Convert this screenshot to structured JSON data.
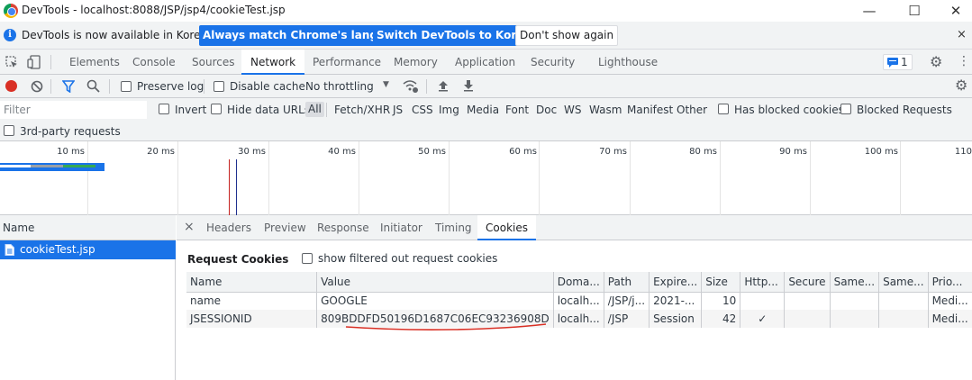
{
  "window": {
    "title": "DevTools - localhost:8088/JSP/jsp4/cookieTest.jsp",
    "minimize": "—",
    "maximize": "☐",
    "close": "✕"
  },
  "infobar": {
    "icon": "info-icon",
    "message": "DevTools is now available in Korean!",
    "buttons": [
      "Always match Chrome's language",
      "Switch DevTools to Korean",
      "Don't show again"
    ],
    "close": "×"
  },
  "panel_tabs": [
    "Elements",
    "Console",
    "Sources",
    "Network",
    "Performance",
    "Memory",
    "Application",
    "Security",
    "Lighthouse"
  ],
  "active_panel": "Network",
  "issues_count": "1",
  "toolbar": {
    "preserve_log": "Preserve log",
    "disable_cache": "Disable cache",
    "throttling": "No throttling"
  },
  "filter": {
    "placeholder": "Filter",
    "invert": "Invert",
    "hide_data_urls": "Hide data URLs",
    "types": [
      "All",
      "Fetch/XHR",
      "JS",
      "CSS",
      "Img",
      "Media",
      "Font",
      "Doc",
      "WS",
      "Wasm",
      "Manifest",
      "Other"
    ],
    "active_type": "All",
    "has_blocked_cookies": "Has blocked cookies",
    "blocked_requests": "Blocked Requests",
    "third_party": "3rd-party requests"
  },
  "timeline": {
    "ticks": [
      "10 ms",
      "20 ms",
      "30 ms",
      "40 ms",
      "50 ms",
      "60 ms",
      "70 ms",
      "80 ms",
      "90 ms",
      "100 ms",
      "110"
    ],
    "colors": {
      "blue_line": "#1a73e8",
      "red_line": "#c5221f",
      "dcl_line": "#1e2f8f"
    }
  },
  "requests": {
    "header": "Name",
    "items": [
      "cookieTest.jsp"
    ]
  },
  "details": {
    "close": "×",
    "tabs": [
      "Headers",
      "Preview",
      "Response",
      "Initiator",
      "Timing",
      "Cookies"
    ],
    "active_tab": "Cookies",
    "section_title": "Request Cookies",
    "show_filtered": "show filtered out request cookies",
    "columns": [
      "Name",
      "Value",
      "Doma...",
      "Path",
      "Expire...",
      "Size",
      "Http...",
      "Secure",
      "Same...",
      "Same...",
      "Prio..."
    ],
    "rows": [
      [
        "name",
        "GOOGLE",
        "localh...",
        "/JSP/j...",
        "2021-...",
        "10",
        "",
        "",
        "",
        "",
        "Medi..."
      ],
      [
        "JSESSIONID",
        "809BDDFD50196D1687C06EC93236908D",
        "localh...",
        "/JSP",
        "Session",
        "42",
        "✓",
        "",
        "",
        "",
        "Medi..."
      ]
    ]
  },
  "annotation_color": "#d93025"
}
